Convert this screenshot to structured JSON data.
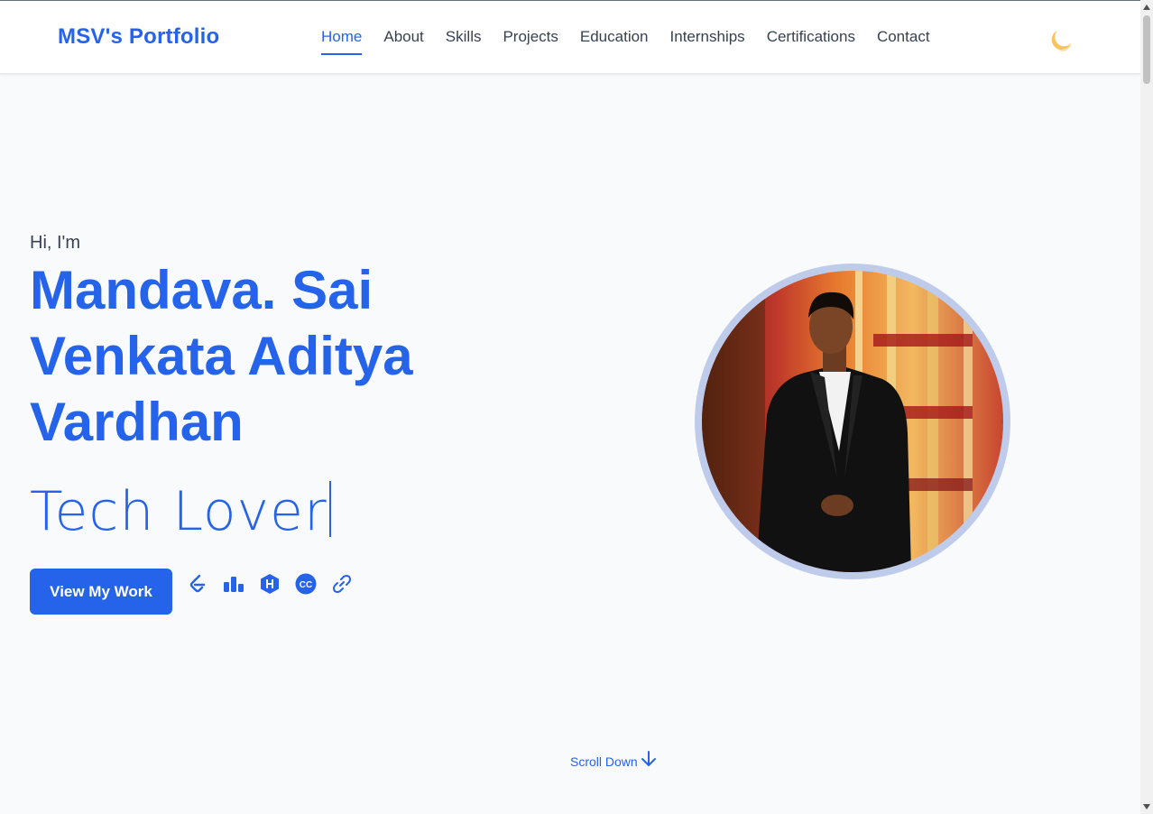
{
  "header": {
    "logo": "MSV's Portfolio",
    "nav": [
      {
        "label": "Home",
        "active": true
      },
      {
        "label": "About"
      },
      {
        "label": "Skills"
      },
      {
        "label": "Projects"
      },
      {
        "label": "Education"
      },
      {
        "label": "Internships"
      },
      {
        "label": "Certifications"
      },
      {
        "label": "Contact"
      }
    ],
    "theme_icon": "moon-icon"
  },
  "hero": {
    "greeting": "Hi, I'm",
    "name": "Mandava. Sai Venkata Aditya Vardhan",
    "typed_text": "Tech Lover",
    "cta_label": "View My Work",
    "socials": [
      "leetcode-icon",
      "codeforces-icon",
      "hackerrank-icon",
      "codechef-icon",
      "link-icon"
    ],
    "photo": "profile-photo"
  },
  "scroll_hint": "Scroll Down",
  "colors": {
    "accent": "#2563eb",
    "background": "#f8fafc",
    "ring": "#bfcbea"
  }
}
